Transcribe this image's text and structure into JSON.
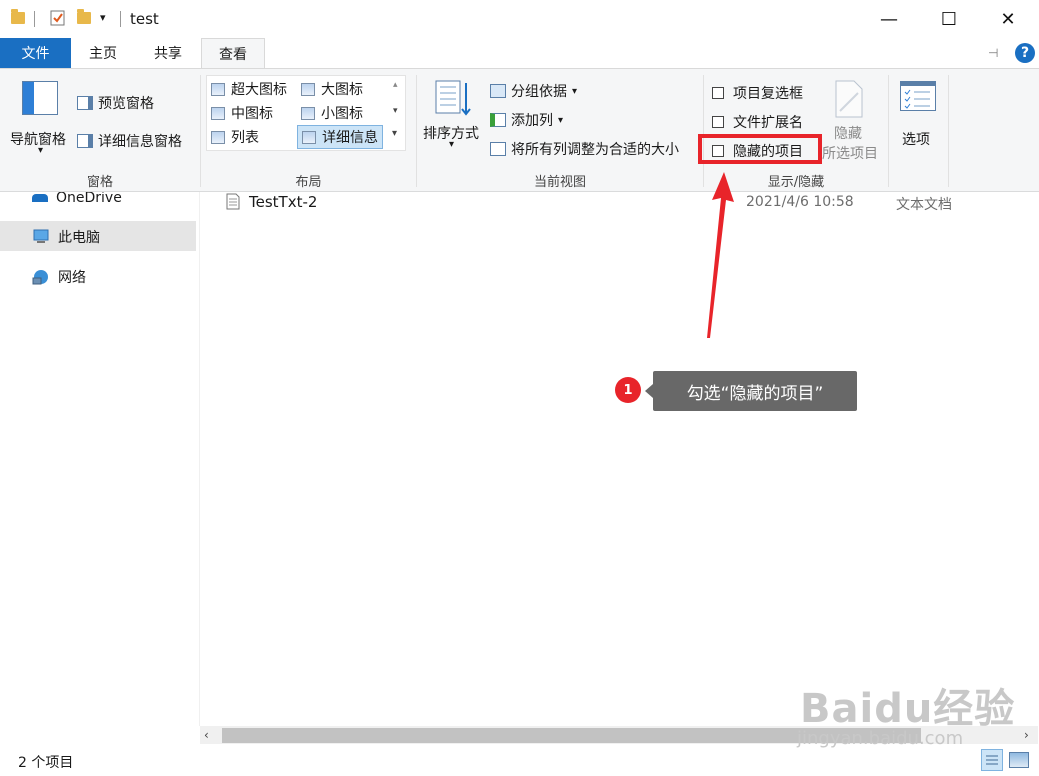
{
  "window": {
    "title": "test",
    "minimize": "—",
    "maximize": "☐",
    "close": "✕"
  },
  "tabs": {
    "file": "文件",
    "home": "主页",
    "share": "共享",
    "view": "查看"
  },
  "ribbon": {
    "panes": {
      "nav_pane": "导航窗格",
      "preview_pane": "预览窗格",
      "details_pane": "详细信息窗格",
      "group_label": "窗格"
    },
    "layout": {
      "items": [
        "超大图标",
        "大图标",
        "中图标",
        "小图标",
        "列表",
        "详细信息"
      ],
      "group_label": "布局"
    },
    "current_view": {
      "sort_by": "排序方式",
      "group_by": "分组依据",
      "add_columns": "添加列",
      "size_columns": "将所有列调整为合适的大小",
      "group_label": "当前视图"
    },
    "show_hide": {
      "item_checkboxes": "项目复选框",
      "file_extensions": "文件扩展名",
      "hidden_items": "隐藏的项目",
      "hide_selected_line1": "隐藏",
      "hide_selected_line2": "所选项目",
      "group_label": "显示/隐藏"
    },
    "options": "选项"
  },
  "nav_pane": {
    "items": [
      "OneDrive",
      "此电脑",
      "网络"
    ]
  },
  "file_list": {
    "rows": [
      {
        "name": "TestTxt-2",
        "date": "2021/4/6 10:58",
        "type": "文本文档"
      }
    ]
  },
  "status": {
    "item_count": "2 个项目"
  },
  "annotation": {
    "step": "1",
    "text": "勾选“隐藏的项目”"
  },
  "watermark": {
    "logo": "Baidu经验",
    "url": "jingyan.baidu.com"
  },
  "colors": {
    "accent": "#1a6fc2",
    "annotation_red": "#e8242a",
    "callout_bg": "#686868"
  }
}
